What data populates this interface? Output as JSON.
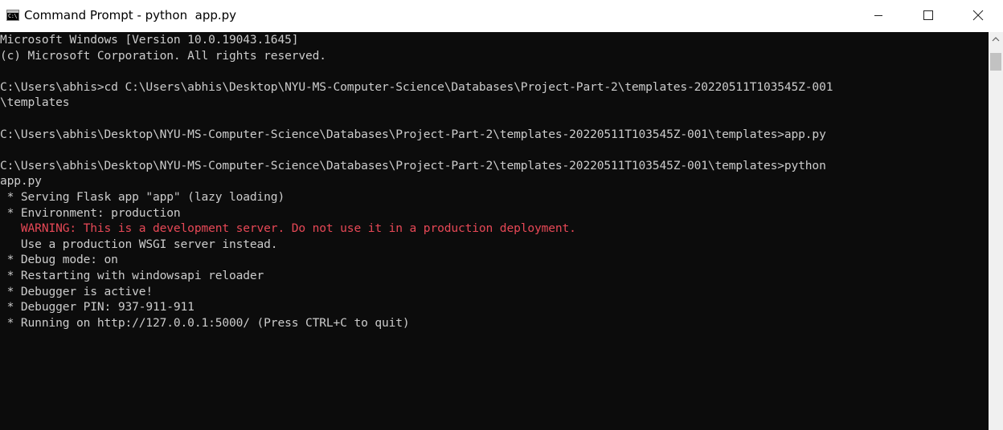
{
  "window": {
    "title": "Command Prompt - python  app.py",
    "icon_text": "C:\\",
    "controls": {
      "minimize_icon": "minimize-icon",
      "maximize_icon": "maximize-icon",
      "close_icon": "close-icon"
    }
  },
  "terminal": {
    "colors": {
      "background": "#0c0c0c",
      "text": "#cccccc",
      "warning": "#e74856"
    },
    "lines": [
      {
        "text": "Microsoft Windows [Version 10.0.19043.1645]",
        "type": "normal"
      },
      {
        "text": "(c) Microsoft Corporation. All rights reserved.",
        "type": "normal"
      },
      {
        "text": "",
        "type": "normal"
      },
      {
        "text": "C:\\Users\\abhis>cd C:\\Users\\abhis\\Desktop\\NYU-MS-Computer-Science\\Databases\\Project-Part-2\\templates-20220511T103545Z-001",
        "type": "normal"
      },
      {
        "text": "\\templates",
        "type": "normal"
      },
      {
        "text": "",
        "type": "normal"
      },
      {
        "text": "C:\\Users\\abhis\\Desktop\\NYU-MS-Computer-Science\\Databases\\Project-Part-2\\templates-20220511T103545Z-001\\templates>app.py",
        "type": "normal"
      },
      {
        "text": "",
        "type": "normal"
      },
      {
        "text": "C:\\Users\\abhis\\Desktop\\NYU-MS-Computer-Science\\Databases\\Project-Part-2\\templates-20220511T103545Z-001\\templates>python",
        "type": "normal"
      },
      {
        "text": "app.py",
        "type": "normal"
      },
      {
        "text": " * Serving Flask app \"app\" (lazy loading)",
        "type": "normal"
      },
      {
        "text": " * Environment: production",
        "type": "normal"
      },
      {
        "text": "   WARNING: This is a development server. Do not use it in a production deployment.",
        "type": "warn"
      },
      {
        "text": "   Use a production WSGI server instead.",
        "type": "normal"
      },
      {
        "text": " * Debug mode: on",
        "type": "normal"
      },
      {
        "text": " * Restarting with windowsapi reloader",
        "type": "normal"
      },
      {
        "text": " * Debugger is active!",
        "type": "normal"
      },
      {
        "text": " * Debugger PIN: 937-911-911",
        "type": "normal"
      },
      {
        "text": " * Running on http://127.0.0.1:5000/ (Press CTRL+C to quit)",
        "type": "normal"
      }
    ]
  },
  "scrollbar": {
    "up_icon": "scroll-up-icon"
  }
}
